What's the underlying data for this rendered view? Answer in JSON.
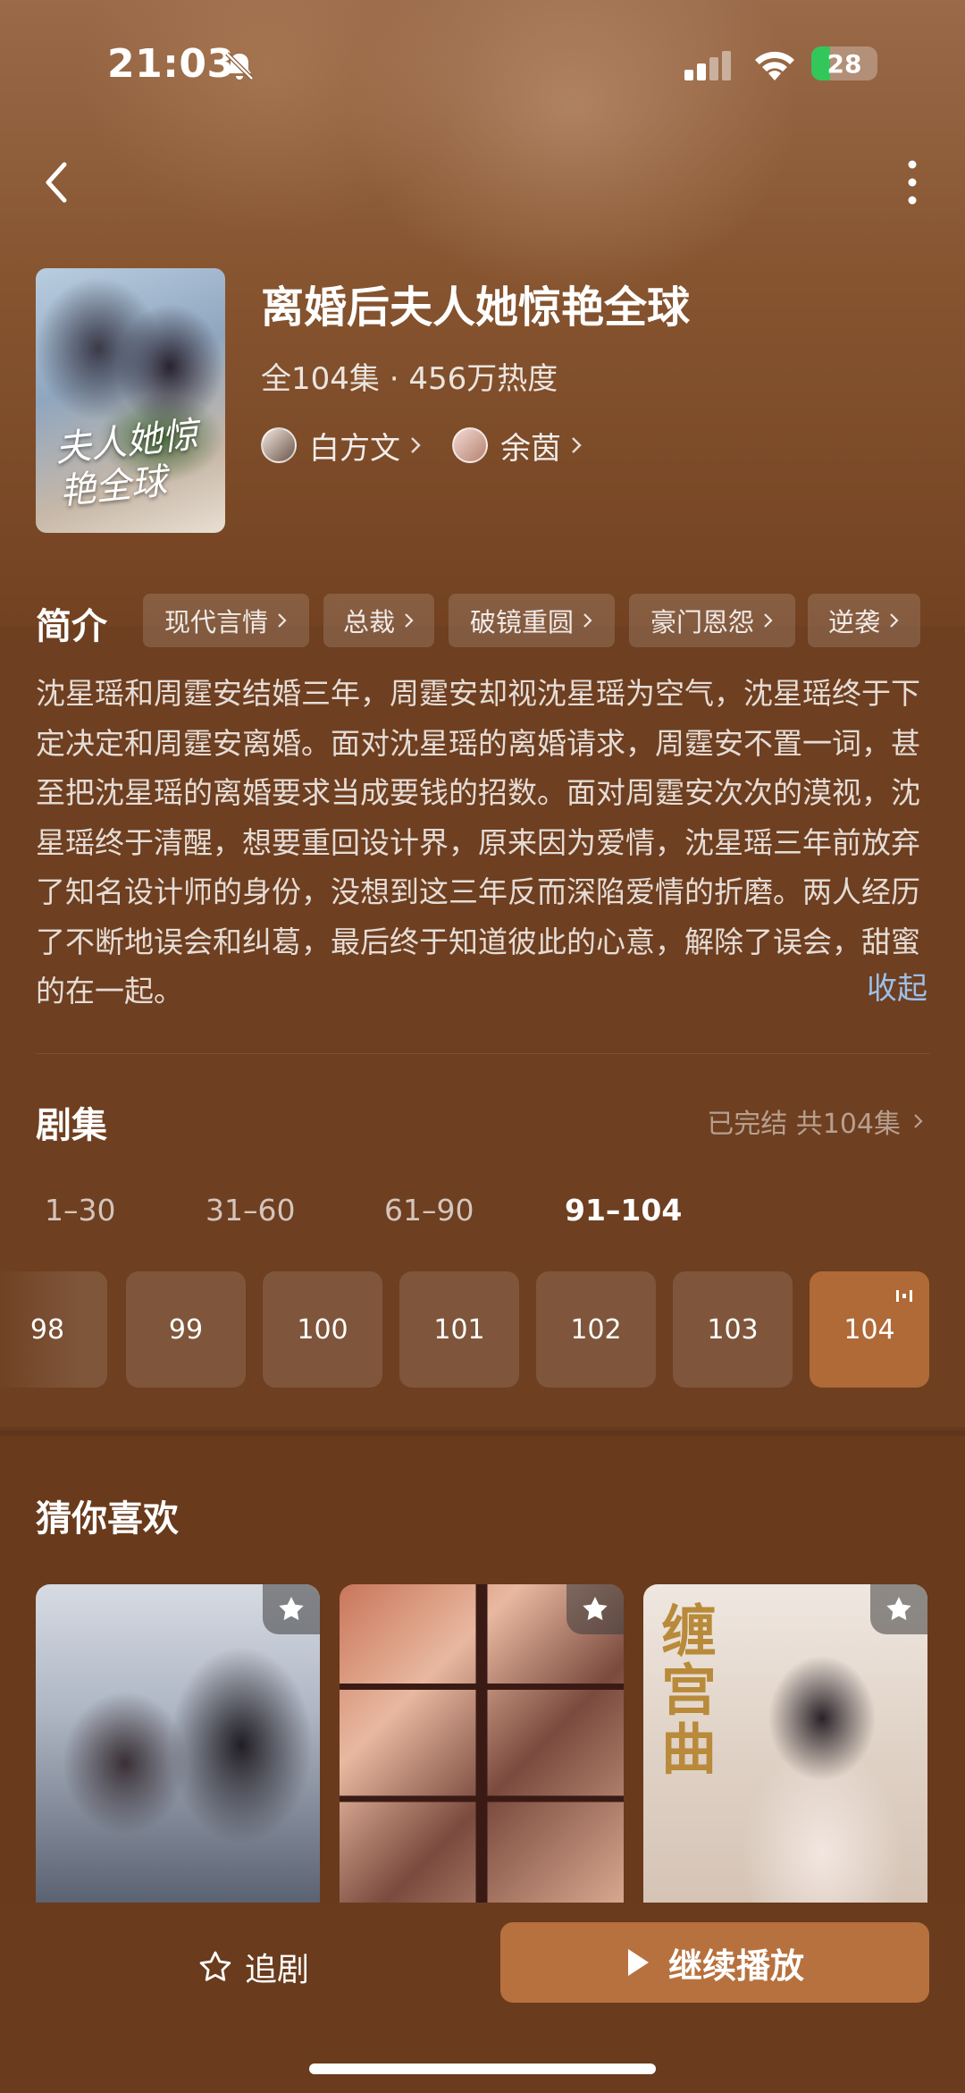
{
  "status_bar": {
    "time": "21:03",
    "battery": "28",
    "battery_level": 0.28
  },
  "drama": {
    "title": "离婚后夫人她惊艳全球",
    "meta": "全104集 · 456万热度",
    "poster_text": "夫人她惊艳全球",
    "actors": [
      {
        "name": "白方文"
      },
      {
        "name": "余茵"
      }
    ]
  },
  "intro": {
    "heading": "简介",
    "tags": [
      "现代言情",
      "总裁",
      "破镜重圆",
      "豪门恩怨",
      "逆袭"
    ],
    "synopsis": "沈星瑶和周霆安结婚三年，周霆安却视沈星瑶为空气，沈星瑶终于下定决定和周霆安离婚。面对沈星瑶的离婚请求，周霆安不置一词，甚至把沈星瑶的离婚要求当成要钱的招数。面对周霆安次次的漠视，沈星瑶终于清醒，想要重回设计界，原来因为爱情，沈星瑶三年前放弃了知名设计师的身份，没想到这三年反而深陷爱情的折磨。两人经历了不断地误会和纠葛，最后终于知道彼此的心意，解除了误会，甜蜜的在一起。",
    "collapse_label": "收起"
  },
  "episodes": {
    "heading": "剧集",
    "status": "已完结 共104集",
    "ranges": [
      "1–30",
      "31–60",
      "61–90",
      "91–104"
    ],
    "active_range": "91–104",
    "visible": [
      "98",
      "99",
      "100",
      "101",
      "102",
      "103",
      "104"
    ],
    "current": "104"
  },
  "recommend": {
    "heading": "猜你喜欢",
    "card3_text": "缠宫曲"
  },
  "bottom": {
    "follow_label": "追剧",
    "play_label": "继续播放"
  },
  "colors": {
    "background": "#6e3f20",
    "accent": "#b7713e",
    "link": "#9cc0ea"
  }
}
